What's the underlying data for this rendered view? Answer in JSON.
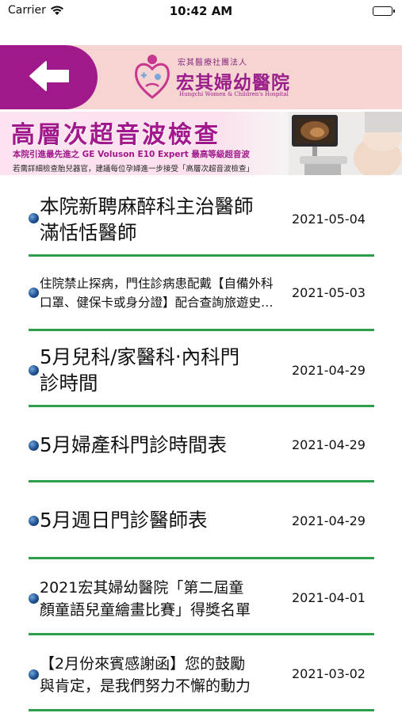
{
  "status_bar": {
    "carrier": "Carrier",
    "time": "10:42 AM"
  },
  "header": {
    "back_icon": "arrow-left-icon",
    "logo": {
      "org": "宏其醫療社團法人",
      "name": "宏其婦幼醫院",
      "english": "Hungchi Women & Children's Hospital"
    }
  },
  "banner": {
    "title": "高層次超音波檢查",
    "line1": "本院引進最先進之 GE  Voluson E10 Expert 最高等級超音波",
    "line2": "若需詳細檢查胎兒器官，建議每位孕婦進一步接受「高層次超音波檢查」"
  },
  "news": [
    {
      "title_lines": [
        "本院新聘麻醉科主治醫師",
        "滿恬恬醫師"
      ],
      "date": "2021-05-04"
    },
    {
      "title_lines": [
        "住院禁止探病，門住診病患配戴【自備外科",
        "口罩、健保卡或身分證】配合查詢旅遊史…"
      ],
      "date": "2021-05-03"
    },
    {
      "title_lines": [
        "5月兒科/家醫科‧內科門",
        "診時間"
      ],
      "date": "2021-04-29"
    },
    {
      "title_lines": [
        "5月婦產科門診時間表"
      ],
      "date": "2021-04-29"
    },
    {
      "title_lines": [
        "5月週日門診醫師表"
      ],
      "date": "2021-04-29"
    },
    {
      "title_lines": [
        "2021宏其婦幼醫院「第二屆童",
        "顏童語兒童繪畫比賽」得獎名單"
      ],
      "date": "2021-04-01"
    },
    {
      "title_lines": [
        "【2月份來賓感謝函】您的鼓勵",
        "與肯定，是我們努力不懈的動力"
      ],
      "date": "2021-03-02"
    }
  ],
  "colors": {
    "accent": "#a0198a",
    "header_bg": "#f5d4d2",
    "divider": "#2f9e4a",
    "bullet": "#1e4f92"
  }
}
